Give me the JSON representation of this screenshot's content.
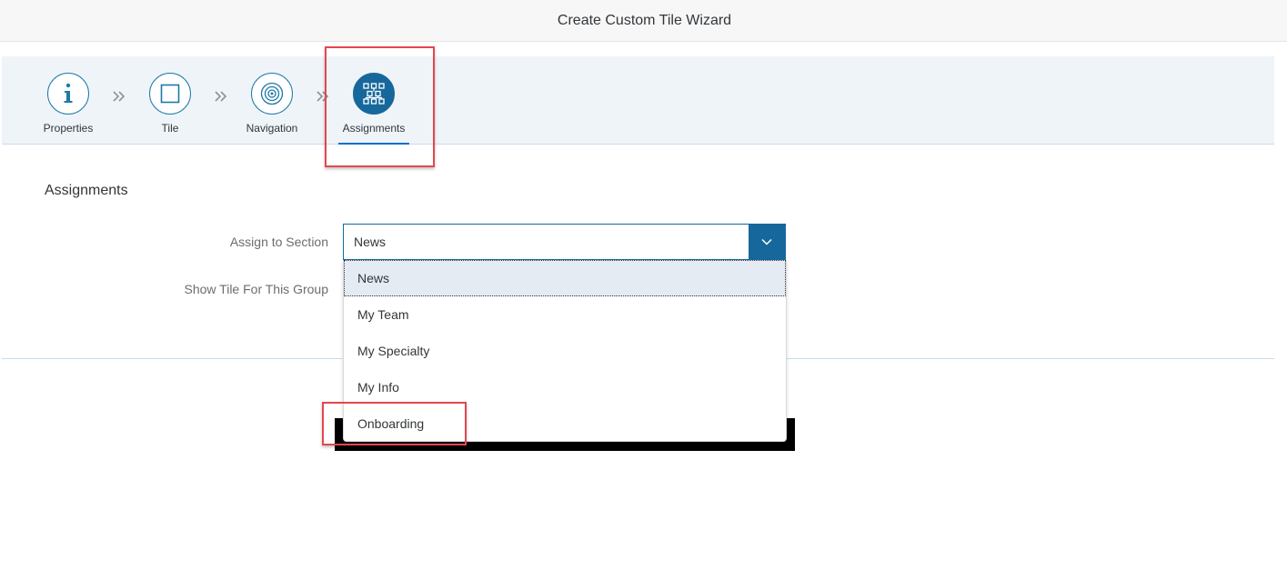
{
  "header": {
    "title": "Create Custom Tile Wizard"
  },
  "wizard": {
    "steps": [
      {
        "label": "Properties",
        "icon": "info-icon"
      },
      {
        "label": "Tile",
        "icon": "square-icon"
      },
      {
        "label": "Navigation",
        "icon": "target-icon"
      },
      {
        "label": "Assignments",
        "icon": "org-chart-icon",
        "active": true
      }
    ],
    "accent_color": "#16689c"
  },
  "main": {
    "section_title": "Assignments",
    "assign_to_section": {
      "label": "Assign to Section",
      "value": "News",
      "options": [
        "News",
        "My Team",
        "My Specialty",
        "My Info",
        "Onboarding"
      ]
    },
    "show_tile_for_group": {
      "label": "Show Tile For This Group"
    }
  },
  "annotations": {
    "highlight_color": "#e4474f"
  }
}
